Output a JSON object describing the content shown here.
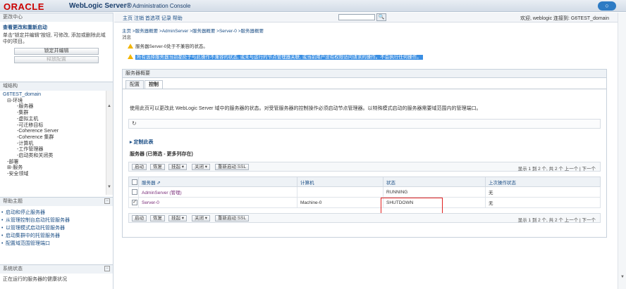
{
  "header": {
    "oracle": "ORACLE",
    "product": "WebLogic Server®",
    "console": "Administration Console",
    "minimize_icon": "○"
  },
  "change_center": {
    "title": "更改中心",
    "subtitle": "查看更改和重新启动",
    "text": "单击\"锁定并编辑\"按钮, 可修改, 添加或删除此域中的项目。",
    "lock_button": "锁定并编辑",
    "release_button": "释放配置"
  },
  "domain_structure": {
    "title": "域结构",
    "items": [
      "G6TEST_domain",
      "⊟-环境",
      "-服务器",
      "-集群",
      "-虚拟主机",
      "-可迁移目标",
      "-Coherence Server",
      "-Coherence 集群",
      "-计算机",
      "-工作管理器",
      "-启动类和关闭类",
      "-部署",
      "⊞-服务",
      "-安全领域"
    ]
  },
  "help": {
    "title": "帮助主题",
    "items": [
      "启动和停止服务器",
      "从管理控制台启动托管服务器",
      "以管理模式启动托管服务器",
      "启动集群中的托管服务器",
      "配置域范围管理端口"
    ]
  },
  "system_status": {
    "title": "系统状态",
    "text": "正在运行的服务器的健康状况"
  },
  "topbar": {
    "nav": "主页  注销  首选项  记录  帮助",
    "search_icon": "search-icon",
    "search_glyph": "🔍",
    "welcome": "欢迎, weblogic  连接到: G6TEST_domain"
  },
  "breadcrumb": "主页 >服务器概要 >AdminServer >服务器概要 >Server-0 >服务器概要",
  "messages": {
    "label": "消息",
    "items": [
      "服务器Server-0处于不兼容的状态。",
      "所有选择服务器当前都处于与此操作不兼容的状态, 或未与运行的节点管理器关联, 或当前用户没有权限访问请求的操作。不会执行任何操作。"
    ]
  },
  "panel": {
    "title": "服务器概要",
    "tabs": [
      "配置",
      "控制"
    ],
    "description": "使用此页可以更改此 WebLogic Server 域中的服务器的状态。对受管服务器的控制操作必须启动节点管理器。以特殊模式启动的服务器需要域范围内的管理端口。",
    "refresh_icon": "↻",
    "customize": "▸ 定制此表",
    "table_title": "服务器 (已筛选 - 更多列存在)",
    "toolbar_buttons": [
      "启动",
      "恢复",
      "挂起 ▾",
      "关闭 ▾",
      "重新启动 SSL"
    ],
    "pager": "显示 1 到 2 个, 共 2 个  上一个 | 下一个",
    "columns": [
      "服务器 ⇗",
      "计算机",
      "状态",
      "上次操作状态"
    ],
    "rows": [
      {
        "checked": "",
        "server": "AdminServer (管理)",
        "machine": "",
        "state": "RUNNING",
        "last": "无"
      },
      {
        "checked": "✓",
        "server": "Server-0",
        "machine": "Machine-0",
        "state": "SHUTDOWN",
        "last": "无"
      }
    ]
  },
  "colors": {
    "accent": "#1c4f86",
    "highlight": "#3b8fe3",
    "warning": "#f2b500",
    "annotation": "#e02020"
  }
}
